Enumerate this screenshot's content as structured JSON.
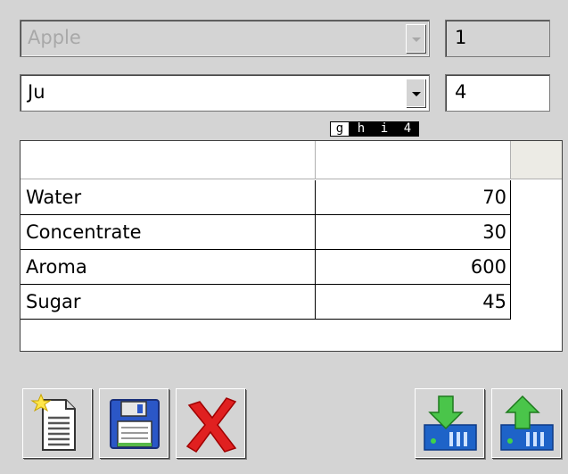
{
  "product_combo": {
    "value": "Apple",
    "enabled": false
  },
  "product_qty": {
    "value": "1"
  },
  "variant_combo": {
    "value": "Ju",
    "enabled": true
  },
  "variant_qty": {
    "value": "4"
  },
  "key_hint": {
    "keys": [
      "g",
      "h",
      "i",
      "4"
    ],
    "selected": "g"
  },
  "table": {
    "columns": [
      "",
      ""
    ],
    "rows": [
      {
        "name": "Water",
        "amount": "70"
      },
      {
        "name": "Concentrate",
        "amount": "30"
      },
      {
        "name": "Aroma",
        "amount": "600"
      },
      {
        "name": "Sugar",
        "amount": "45"
      }
    ]
  },
  "toolbar": {
    "buttons": [
      {
        "icon": "new-document-icon"
      },
      {
        "icon": "save-floppy-icon"
      },
      {
        "icon": "delete-x-icon"
      },
      {
        "icon": "download-in-icon"
      },
      {
        "icon": "upload-out-icon"
      }
    ]
  }
}
